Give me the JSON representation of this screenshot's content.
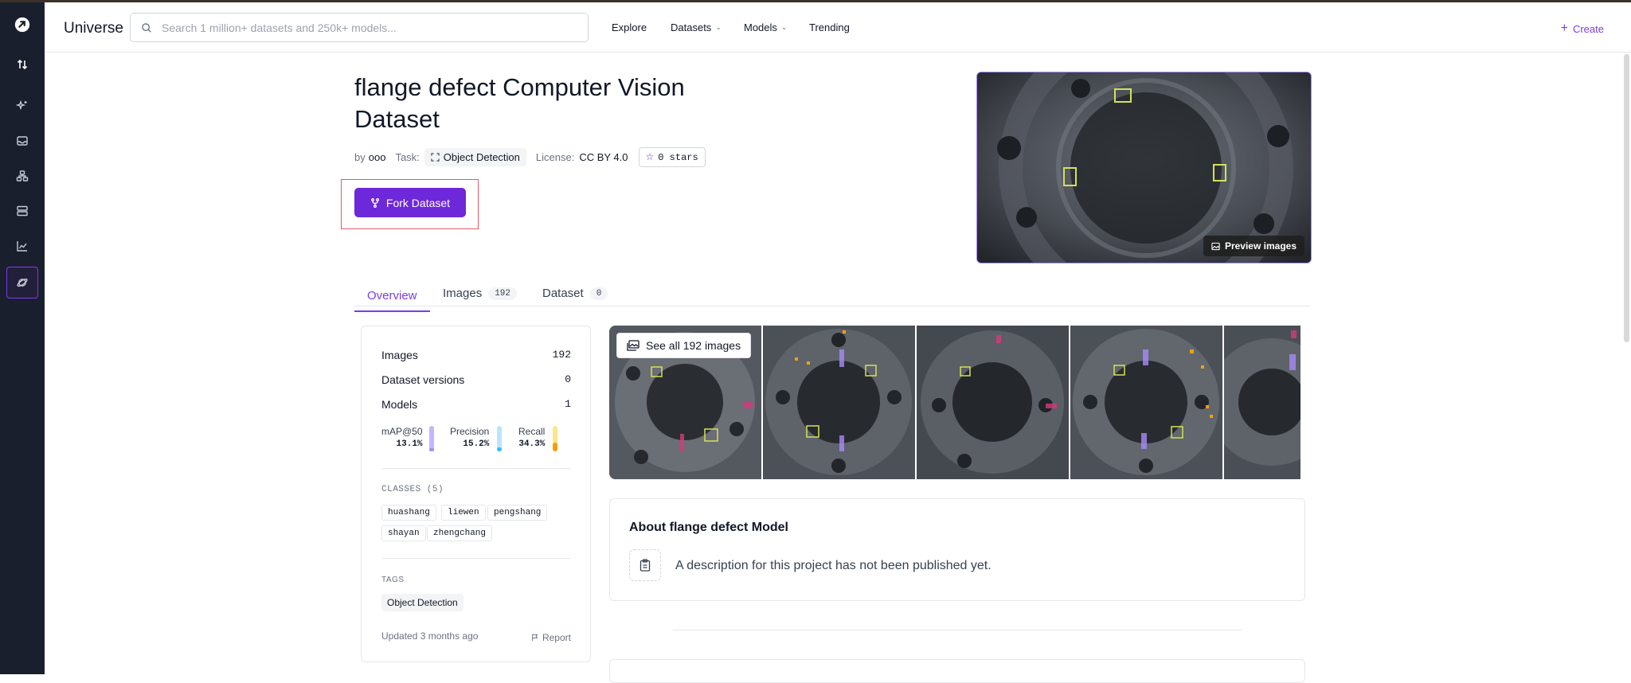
{
  "header": {
    "brand": "Universe",
    "search_placeholder": "Search 1 million+ datasets and 250k+ models...",
    "nav": [
      {
        "label": "Explore",
        "dropdown": false
      },
      {
        "label": "Datasets",
        "dropdown": true
      },
      {
        "label": "Models",
        "dropdown": true
      },
      {
        "label": "Trending",
        "dropdown": false
      }
    ],
    "create_label": "Create"
  },
  "dataset": {
    "title": "flange defect Computer Vision Dataset",
    "by_label": "by",
    "author": "ooo",
    "task_label": "Task:",
    "task": "Object Detection",
    "license_label": "License:",
    "license": "CC BY 4.0",
    "stars": "0 stars",
    "fork_label": "Fork Dataset",
    "preview_label": "Preview images"
  },
  "tabs": [
    {
      "label": "Overview",
      "count": ""
    },
    {
      "label": "Images",
      "count": "192"
    },
    {
      "label": "Dataset",
      "count": "0"
    }
  ],
  "stats": {
    "rows": [
      {
        "label": "Images",
        "value": "192"
      },
      {
        "label": "Dataset versions",
        "value": "0"
      },
      {
        "label": "Models",
        "value": "1"
      }
    ],
    "metrics": [
      {
        "label": "mAP@50",
        "value": "13.1%",
        "percent": 13.1,
        "color": "#c4b5fd",
        "fill": "#a78bfa"
      },
      {
        "label": "Precision",
        "value": "15.2%",
        "percent": 15.2,
        "color": "#bae6fd",
        "fill": "#38bdf8"
      },
      {
        "label": "Recall",
        "value": "34.3%",
        "percent": 34.3,
        "color": "#fde68a",
        "fill": "#f59e0b"
      }
    ],
    "classes_heading": "CLASSES (5)",
    "classes": [
      "huashang",
      "liewen",
      "pengshang",
      "shayan",
      "zhengchang"
    ],
    "tags_heading": "TAGS",
    "tags": [
      "Object Detection"
    ],
    "updated": "Updated 3 months ago",
    "report_label": "Report"
  },
  "gallery": {
    "see_all_label": "See all 192 images"
  },
  "about": {
    "heading": "About flange defect Model",
    "description": "A description for this project has not been published yet."
  },
  "colors": {
    "accent": "#7c3aed",
    "button": "#6d28d9",
    "rail": "#1a1f2e",
    "highlight_box": "#e05a6a",
    "detection_box": "#d4e157"
  }
}
